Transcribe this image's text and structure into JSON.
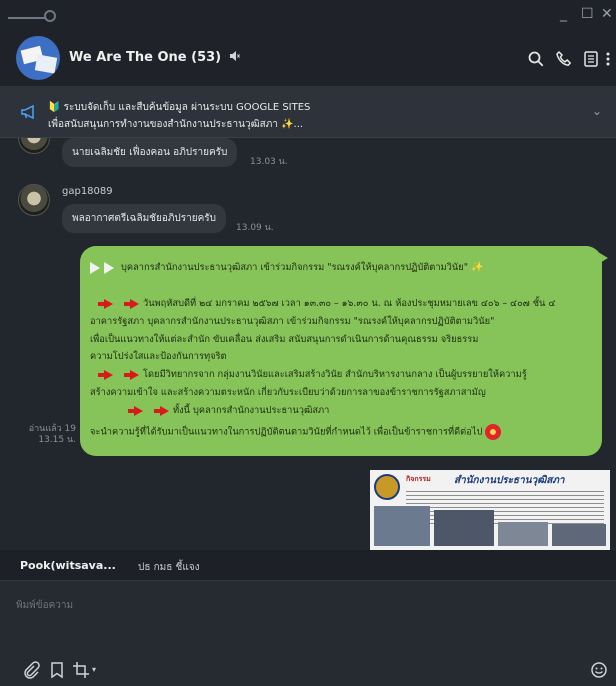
{
  "window": {
    "minimize": "_",
    "maximize": "☐",
    "close": "✕"
  },
  "header": {
    "title": "We Are The One (53)",
    "muted_icon": "volume-mute-icon"
  },
  "announcement": {
    "line1": "🔰 ระบบจัดเก็บ และสืบค้นข้อมูล ผ่านระบบ GOOGLE SITES",
    "line2": "เพื่อสนับสนุนการทำงานของสำนักงานประธานวุฒิสภา ✨..."
  },
  "messages": {
    "m1": {
      "text": "นายเฉลิมชัย เฟื่องคอน อภิปรายครับ",
      "time": "13.03 น."
    },
    "m2": {
      "sender": "gap18089",
      "text": "พลอากาศตรีเฉลิมชัยอภิปรายครับ",
      "time": "13.09 น."
    },
    "outgoing": {
      "line1": "บุคลากรสำนักงานประธานวุฒิสภา เข้าร่วมกิจกรรม \"รณรงค์ให้บุคลากรปฏิบัติตามวินัย\"",
      "line2": "วันพฤหัสบดีที่ ๒๔ มกราคม ๒๕๖๗ เวลา ๑๓.๓๐ – ๑๖.๓๐ น. ณ ห้องประชุมหมายเลข ๔๐๖ – ๔๐๗ ชั้น ๔",
      "line3": "อาคารรัฐสภา บุคลากรสำนักงานประธานวุฒิสภา เข้าร่วมกิจกรรม \"รณรงค์ให้บุคลากรปฏิบัติตามวินัย\"",
      "line4": "เพื่อเป็นแนวทางให้แต่ละสำนัก ขับเคลื่อน ส่งเสริม สนับสนุนการดำเนินการด้านคุณธรรม จริยธรรม",
      "line5": "ความโปร่งใสและป้องกันการทุจริต",
      "line6": "โดยมีวิทยากรจาก กลุ่มงานวินัยและเสริมสร้างวินัย สำนักบริหารงานกลาง เป็นผู้บรรยายให้ความรู้",
      "line7": "สร้างความเข้าใจ และสร้างความตระหนัก เกี่ยวกับระเบียบว่าด้วยการลาของข้าราชการรัฐสภาสามัญ",
      "line8": "ทั้งนี้ บุคลากรสำนักงานประธานวุฒิสภา",
      "line9": "จะนำความรู้ที่ได้รับมาเป็นแนวทางในการปฏิบัติตนตามวินัยที่กำหนดไว้ เพื่อเป็นข้าราชการที่ดีต่อไป",
      "read": "อ่านแล้ว 19",
      "time": "13.15 น."
    },
    "image_preview": {
      "badge": "กิจกรรม",
      "org": "สำนักงานประธานวุฒิสภา"
    }
  },
  "reply_bar": {
    "name": "Pook(witsava...",
    "text": "ปธ กมธ ชี้แจง"
  },
  "input": {
    "placeholder": "พิมพ์ข้อความ"
  },
  "colors": {
    "outgoing_bubble": "#86c45a",
    "arrow": "#d91a1a"
  }
}
